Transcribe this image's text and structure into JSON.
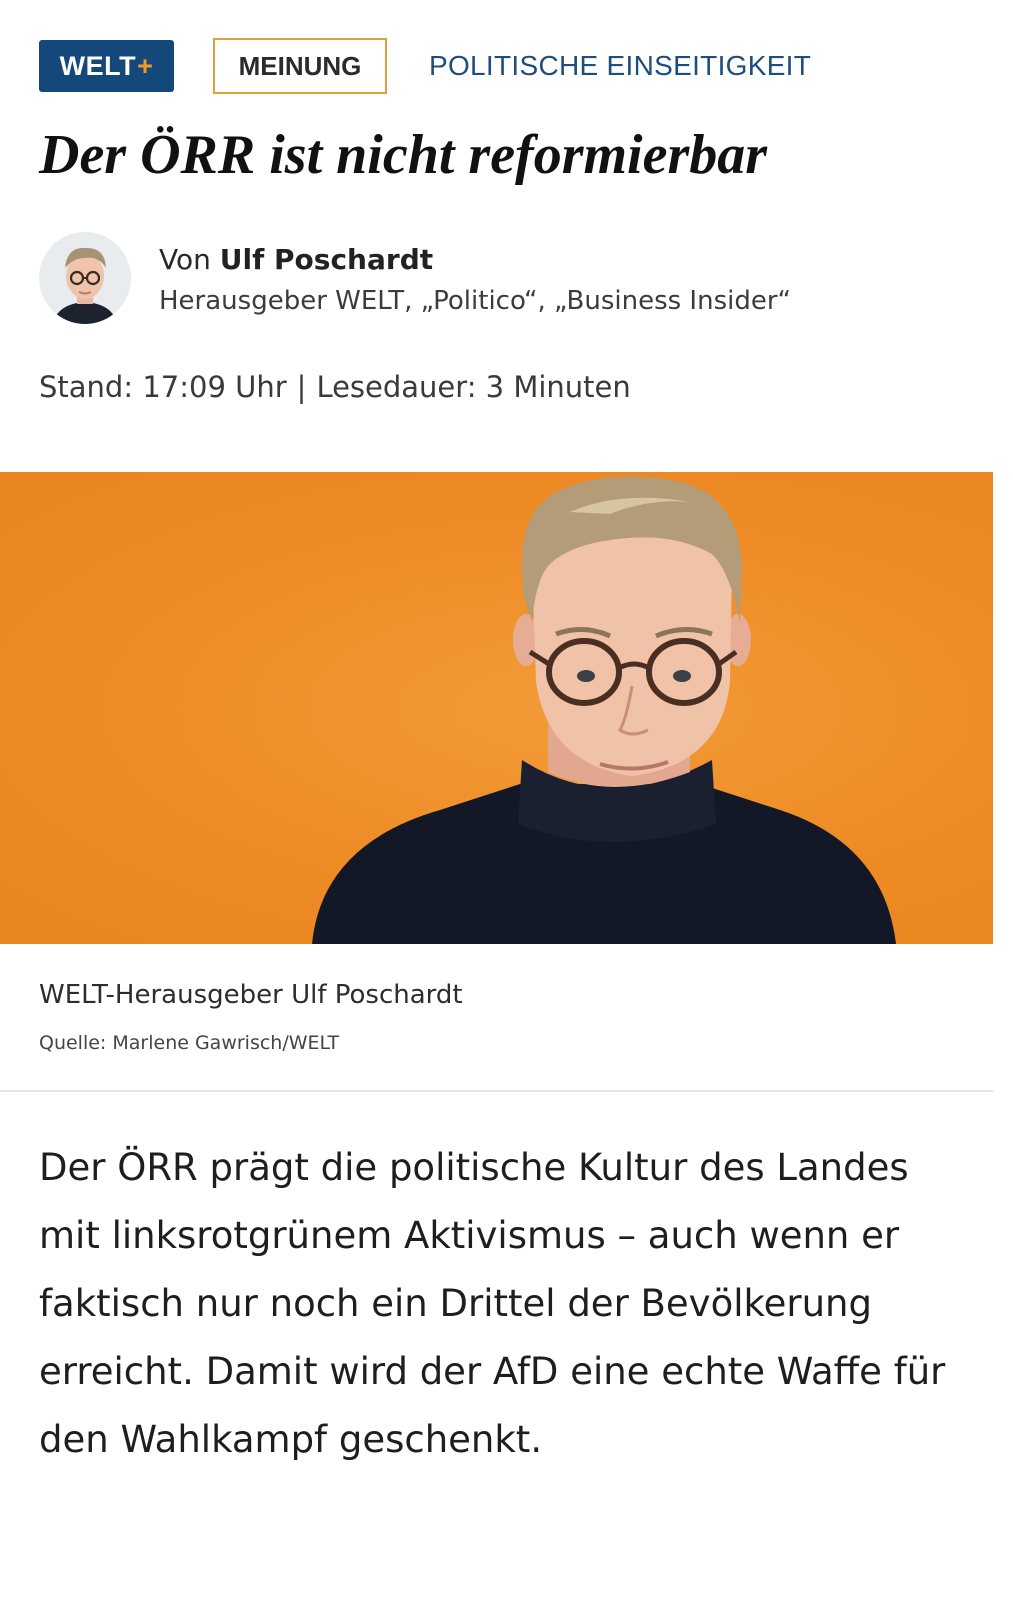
{
  "tags": {
    "brand_text": "WELT",
    "brand_plus": "+",
    "section": "MEINUNG",
    "kicker": "POLITISCHE EINSEITIGKEIT"
  },
  "headline": "Der ÖRR ist nicht reformierbar",
  "author": {
    "prefix": "Von",
    "name": "Ulf Poschardt",
    "role": "Herausgeber WELT, „Politico“, „Business Insider“"
  },
  "meta": {
    "stand": "Stand: 17:09 Uhr",
    "separator": "|",
    "lesedauer": "Lesedauer: 3 Minuten"
  },
  "image": {
    "caption": "WELT-Herausgeber Ulf Poschardt",
    "credit": "Quelle: Marlene Gawrisch/WELT"
  },
  "lead": "Der ÖRR prägt die politische Kultur des Landes mit linksrotgrünem Aktivismus – auch wenn er faktisch nur noch ein Drittel der Bevölkerung erreicht. Damit wird der AfD eine echte Waffe für den Wahlkampf geschenkt.",
  "colors": {
    "brand_blue": "#14487a",
    "brand_plus_orange": "#f39a24",
    "meinung_border": "#e0a03c",
    "kicker_blue": "#1d4e7e",
    "hero_orange": "#ee8b25"
  },
  "icons": [
    "welt-plus-logo",
    "author-avatar-photo",
    "portrait-photo"
  ]
}
